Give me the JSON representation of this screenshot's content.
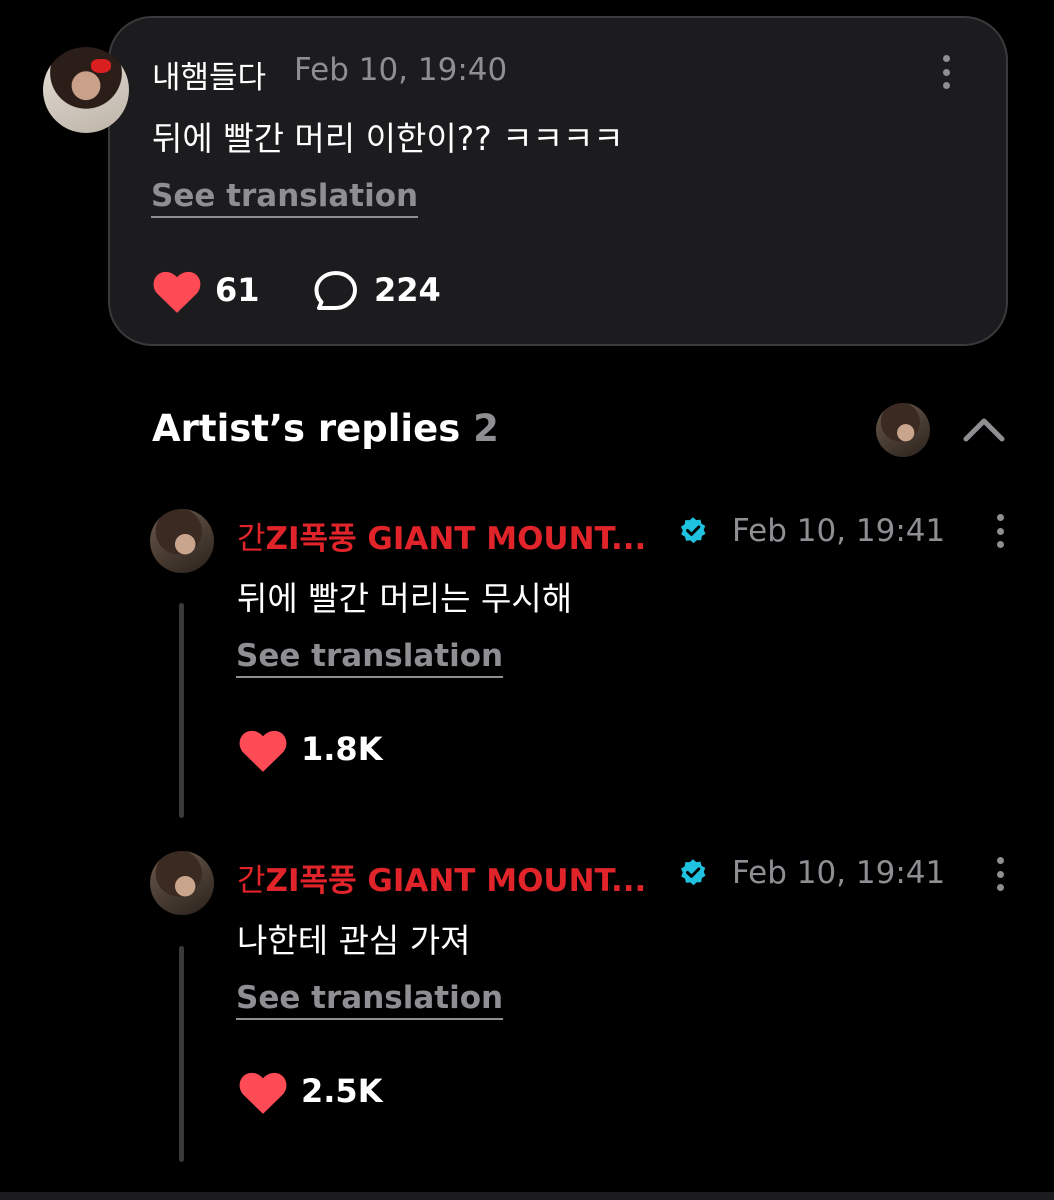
{
  "main_comment": {
    "username": "내햄들다",
    "time": "Feb 10, 19:40",
    "text": "뒤에 빨간 머리 이한이?? ㅋㅋㅋㅋ",
    "see_translation": "See translation",
    "likes": "61",
    "replies": "224"
  },
  "artist_replies": {
    "title": "Artist’s replies",
    "count": "2",
    "items": [
      {
        "author_prefix": "간",
        "author_rest": "ZI폭풍 GIANT MOUNT...",
        "time": "Feb 10, 19:41",
        "text": "뒤에 빨간 머리는 무시해",
        "see_translation": "See translation",
        "likes": "1.8K"
      },
      {
        "author_prefix": "간",
        "author_rest": "ZI폭풍 GIANT MOUNT...",
        "time": "Feb 10, 19:41",
        "text": "나한테 관심 가져",
        "see_translation": "See translation",
        "likes": "2.5K"
      }
    ]
  },
  "colors": {
    "background": "#000000",
    "card": "#1c1c1e",
    "heart": "#ff4b55",
    "artist_name": "#e0242a",
    "verified": "#1fc3e0",
    "muted": "#8e8e93"
  },
  "icons": [
    "heart-icon",
    "comment-bubble-icon",
    "more-options-icon",
    "verified-badge-icon",
    "chevron-up-icon"
  ]
}
